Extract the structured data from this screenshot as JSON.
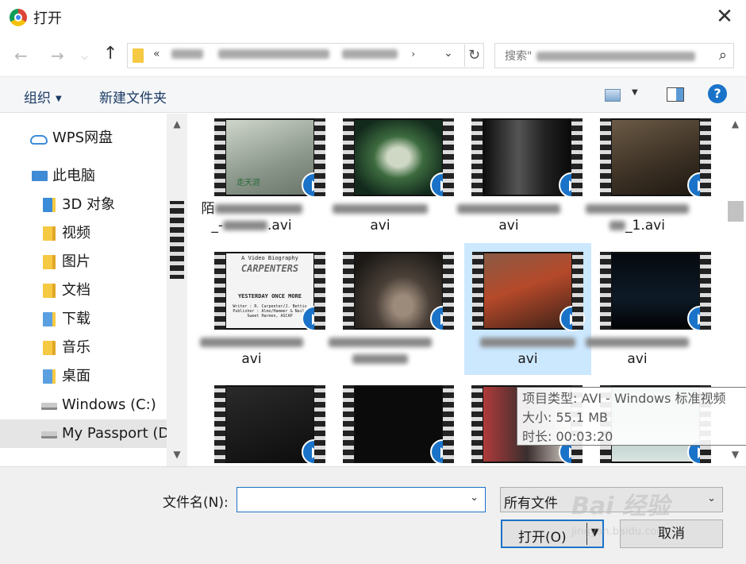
{
  "window": {
    "title": "打开"
  },
  "address": {
    "prefix": "«",
    "search_placeholder": "搜索\""
  },
  "toolbar": {
    "organize": "组织",
    "new_folder": "新建文件夹",
    "help": "?"
  },
  "nav": {
    "items": [
      {
        "label": "WPS网盘",
        "icon": "cloud-icon"
      },
      {
        "label": "此电脑",
        "icon": "computer-icon"
      },
      {
        "label": "3D 对象",
        "icon": "folder-3d-icon"
      },
      {
        "label": "视频",
        "icon": "folder-video-icon"
      },
      {
        "label": "图片",
        "icon": "folder-pictures-icon"
      },
      {
        "label": "文档",
        "icon": "folder-documents-icon"
      },
      {
        "label": "下载",
        "icon": "folder-downloads-icon"
      },
      {
        "label": "音乐",
        "icon": "folder-music-icon"
      },
      {
        "label": "桌面",
        "icon": "folder-desktop-icon"
      },
      {
        "label": "Windows (C:)",
        "icon": "drive-icon"
      },
      {
        "label": "My Passport (D",
        "icon": "external-drive-icon"
      }
    ]
  },
  "files": [
    {
      "l1_pre": "陌",
      "l1_post": "",
      "l2_pre": "_-",
      "l2_post": ".avi",
      "caption": "走天涯"
    },
    {
      "l1_pre": "",
      "l1_post": "",
      "l2_pre": "",
      "l2_post": "avi"
    },
    {
      "l1_pre": "",
      "l1_post": "",
      "l2_pre": "",
      "l2_post": "avi"
    },
    {
      "l1_pre": "",
      "l1_post": "",
      "l2_pre": "",
      "l2_post": "_1.avi"
    },
    {
      "l1_pre": "",
      "l1_post": "",
      "l2_pre": "",
      "l2_post": "avi",
      "poster": {
        "line1": "A Video Biography",
        "line2": "CARPENTERS",
        "line3": "YESTERDAY ONCE MORE",
        "credits": "Writer : R. Carpenter/J. Bettis\nPublisher : Almo/Hammer & Nail,\nSweet Harmon, ASCAP"
      }
    },
    {
      "l1_pre": "",
      "l1_post": "",
      "l2_pre": "",
      "l2_post": ""
    },
    {
      "l1_pre": "",
      "l1_post": "",
      "l2_pre": "",
      "l2_post": "avi"
    },
    {
      "l1_pre": "",
      "l1_post": "",
      "l2_pre": "",
      "l2_post": "avi"
    }
  ],
  "tooltip": {
    "type": "项目类型: AVI - Windows 标准视频",
    "size": "大小: 55.1 MB",
    "duration": "时长: 00:03:20"
  },
  "bottom": {
    "filename_label": "文件名(N):",
    "filename_value": "",
    "filetype": "所有文件",
    "open": "打开(O)",
    "cancel": "取消"
  },
  "watermark": {
    "brand": "Bai 经验",
    "url": "jingyan.baidu.com"
  }
}
